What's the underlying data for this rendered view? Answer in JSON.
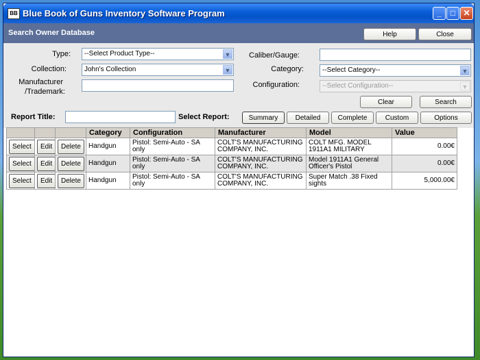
{
  "window": {
    "title": "Blue Book of Guns Inventory Software Program",
    "icon_label": "BB"
  },
  "header": {
    "title": "Search Owner Database",
    "help_label": "Help",
    "close_label": "Close"
  },
  "form": {
    "type_label": "Type:",
    "type_value": "--Select Product Type--",
    "collection_label": "Collection:",
    "collection_value": "John's Collection",
    "manufacturer_label_1": "Manufacturer",
    "manufacturer_label_2": "/Trademark:",
    "manufacturer_value": "",
    "caliber_label": "Caliber/Gauge:",
    "caliber_value": "",
    "category_label": "Category:",
    "category_value": "--Select Category--",
    "configuration_label": "Configuration:",
    "configuration_value": "--Select Configuration--",
    "clear_label": "Clear",
    "search_label": "Search",
    "report_title_label": "Report Title:",
    "report_title_value": "",
    "select_report_label": "Select Report:",
    "report_buttons": {
      "summary": "Summary",
      "detailed": "Detailed",
      "complete": "Complete",
      "custom": "Custom",
      "options": "Options"
    }
  },
  "table": {
    "headers": [
      "Category",
      "Configuration",
      "Manufacturer",
      "Model",
      "Value"
    ],
    "select_label": "Select",
    "edit_label": "Edit",
    "delete_label": "Delete",
    "rows": [
      {
        "category": "Handgun",
        "configuration": "Pistol: Semi-Auto - SA only",
        "manufacturer": "COLT'S MANUFACTURING COMPANY, INC.",
        "model": "COLT MFG. MODEL 1911A1 MILITARY",
        "value": "0.00€"
      },
      {
        "category": "Handgun",
        "configuration": "Pistol: Semi-Auto - SA only",
        "manufacturer": "COLT'S MANUFACTURING COMPANY, INC.",
        "model": "Model 1911A1 General Officer's Pistol",
        "value": "0.00€"
      },
      {
        "category": "Handgun",
        "configuration": "Pistol: Semi-Auto - SA only",
        "manufacturer": "COLT'S MANUFACTURING COMPANY, INC.",
        "model": "Super Match .38 Fixed sights",
        "value": "5,000.00€"
      }
    ]
  },
  "colors": {
    "titlebar": "#0553c8",
    "header_bar": "#5b6f98",
    "form_bg": "#e9e9e9",
    "grid_header": "#d4d0c8"
  },
  "icons": {
    "minimize": "minimize-icon",
    "maximize": "maximize-icon",
    "close": "close-icon",
    "dropdown": "chevron-down-icon"
  }
}
